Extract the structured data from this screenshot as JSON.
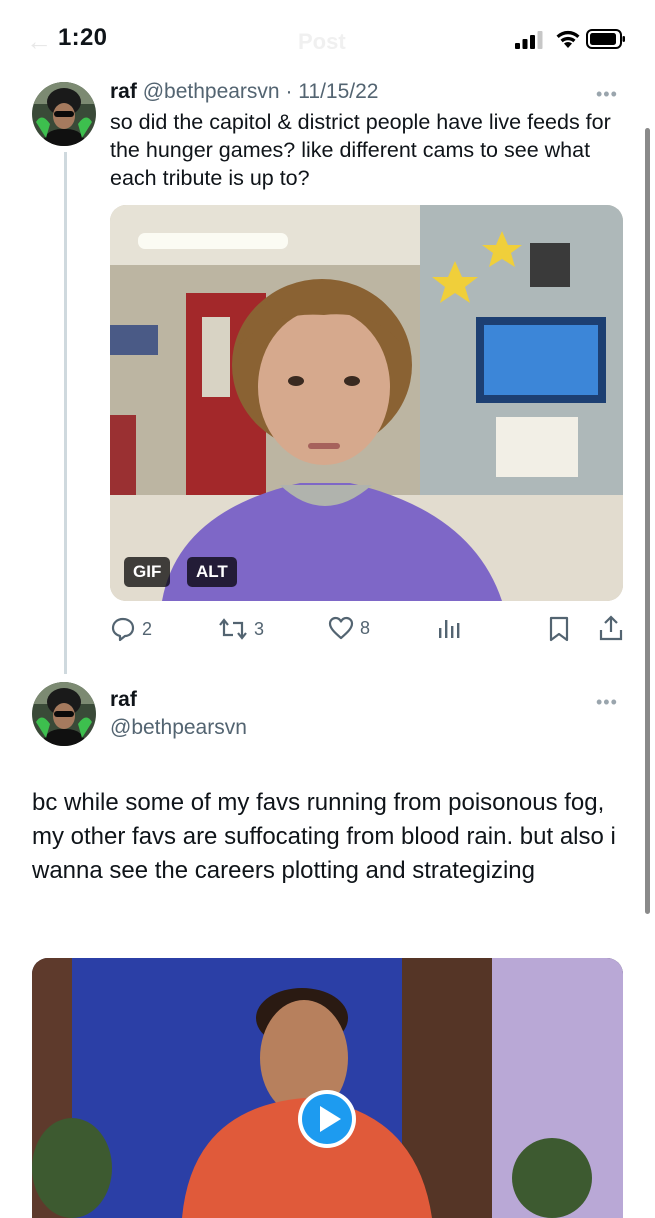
{
  "status_bar": {
    "time": "1:20"
  },
  "header": {
    "title": "Post"
  },
  "tweet1": {
    "name": "raf",
    "handle": "@bethpearsvn",
    "separator": "·",
    "date": "11/15/22",
    "more": "•••",
    "text": "so did the capitol & district people have live feeds for the hunger games? like different cams to see what each tribute is up to?",
    "media": {
      "gif_badge": "GIF",
      "alt_badge": "ALT"
    },
    "actions": {
      "replies": "2",
      "reposts": "3",
      "likes": "8"
    }
  },
  "tweet2": {
    "name": "raf",
    "handle": "@bethpearsvn",
    "more": "•••",
    "text": "bc while some of my favs running from poisonous fog, my other favs are suffocating from blood rain. but also i wanna see the careers plotting and strategizing"
  },
  "icons": [
    "back-icon",
    "signal-icon",
    "wifi-icon",
    "battery-icon",
    "more-icon",
    "reply-icon",
    "repost-icon",
    "like-icon",
    "views-icon",
    "bookmark-icon",
    "share-icon",
    "play-icon"
  ],
  "colors": {
    "text": "#0f1419",
    "secondary": "#536471",
    "thread_line": "#cfd9de",
    "play_button": "#1d9bf0"
  }
}
